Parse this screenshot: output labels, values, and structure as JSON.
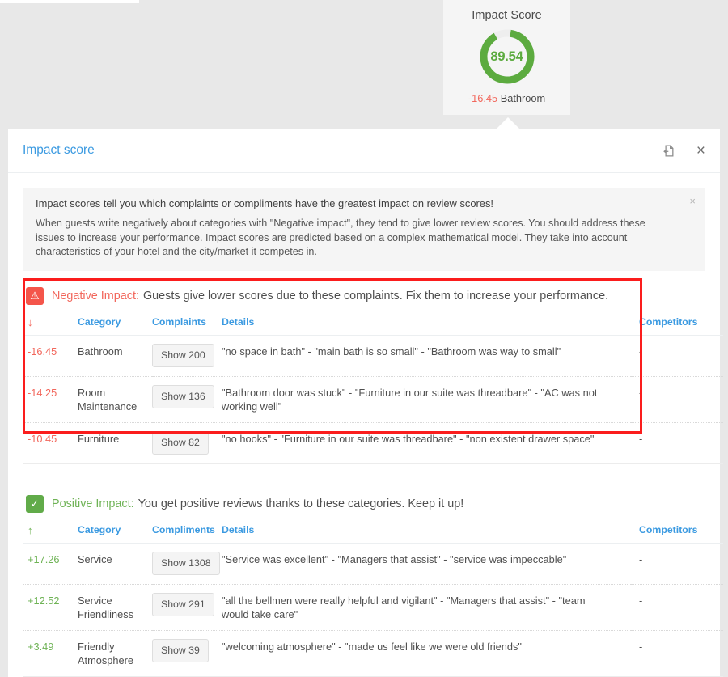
{
  "score_card": {
    "title": "Impact Score",
    "value": "89.54",
    "value_pct": 89.54,
    "sub_score": "-16.45",
    "sub_label": "Bathroom",
    "ring_color": "#5cab3f",
    "ring_track_color": "#eeeeee",
    "negative_color": "#f2675c"
  },
  "panel": {
    "title": "Impact score",
    "export_icon": "export-icon",
    "close_icon": "×"
  },
  "info": {
    "title": "Impact scores tell you which complaints or compliments have the greatest impact on review scores!",
    "body": "When guests write negatively about categories with \"Negative impact\", they tend to give lower review scores. You should address these issues to increase your performance. Impact scores are predicted based on a complex mathematical model. They take into account characteristics of your hotel and the city/market it competes in.",
    "close_icon": "×"
  },
  "negative": {
    "badge_icon": "⚠",
    "label": "Negative Impact:",
    "description": "Guests give lower scores due to these complaints. Fix them to increase your performance.",
    "accent_color": "#f2675c",
    "columns": {
      "arrow": "↓",
      "category": "Category",
      "count": "Complaints",
      "details": "Details",
      "competitors": "Competitors"
    },
    "rows": [
      {
        "score": "-16.45",
        "category": "Bathroom",
        "button": "Show 200",
        "details": "\"no space in bath\" - \"main bath is so small\" - \"Bathroom was way to small\"",
        "competitors": "-"
      },
      {
        "score": "-14.25",
        "category": "Room Maintenance",
        "button": "Show 136",
        "details": "\"Bathroom door was stuck\" - \"Furniture in our suite was threadbare\" - \"AC was not working well\"",
        "competitors": "-"
      },
      {
        "score": "-10.45",
        "category": "Furniture",
        "button": "Show 82",
        "details": "\"no hooks\" - \"Furniture in our suite was threadbare\" - \"non existent drawer space\"",
        "competitors": "-"
      }
    ]
  },
  "positive": {
    "badge_icon": "✓",
    "label": "Positive Impact:",
    "description": "You get positive reviews thanks to these categories. Keep it up!",
    "accent_color": "#6fb356",
    "columns": {
      "arrow": "↑",
      "category": "Category",
      "count": "Compliments",
      "details": "Details",
      "competitors": "Competitors"
    },
    "rows": [
      {
        "score": "+17.26",
        "category": "Service",
        "button": "Show 1308",
        "details": "\"Service was excellent\" - \"Managers that assist\" - \"service was impeccable\"",
        "competitors": "-"
      },
      {
        "score": "+12.52",
        "category": "Service Friendliness",
        "button": "Show 291",
        "details": "\"all the bellmen were really helpful and vigilant\" - \"Managers that assist\" - \"team would take care\"",
        "competitors": "-"
      },
      {
        "score": "+3.49",
        "category": "Friendly Atmosphere",
        "button": "Show 39",
        "details": "\"welcoming atmosphere\" - \"made us feel like we were old friends\"",
        "competitors": "-"
      }
    ]
  }
}
